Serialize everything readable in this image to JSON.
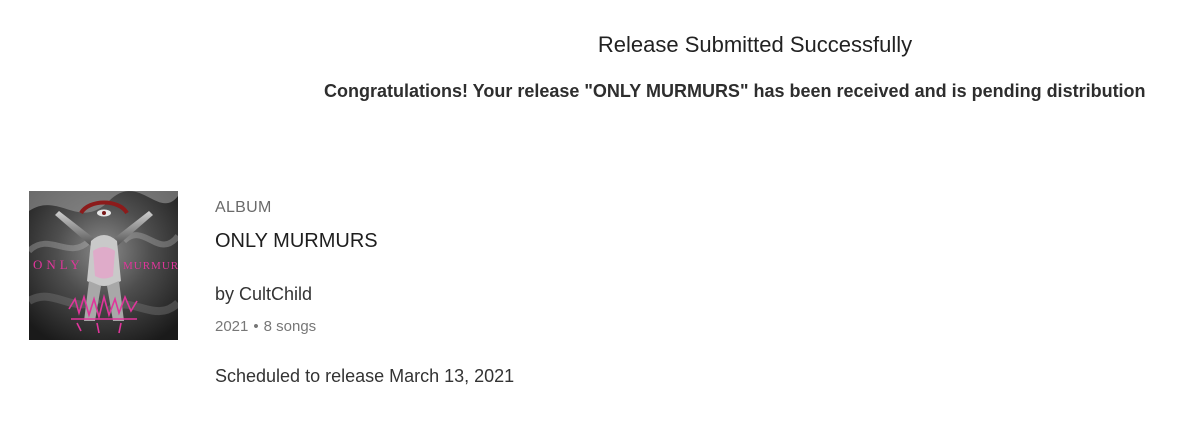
{
  "header": {
    "title": "Release Submitted Successfully",
    "message": "Congratulations! Your release \"ONLY MURMURS\" has been received and is pending distribution"
  },
  "release": {
    "kind": "ALBUM",
    "title": "ONLY MURMURS",
    "artist_line": "by CultChild",
    "year": "2021",
    "separator": "•",
    "song_count": "8 songs",
    "schedule": "Scheduled to release March 13, 2021",
    "cover": {
      "text_left": "ONLY",
      "text_right": "MURMURS",
      "logo_text": "CultChild",
      "accent_color": "#e0359b"
    }
  }
}
